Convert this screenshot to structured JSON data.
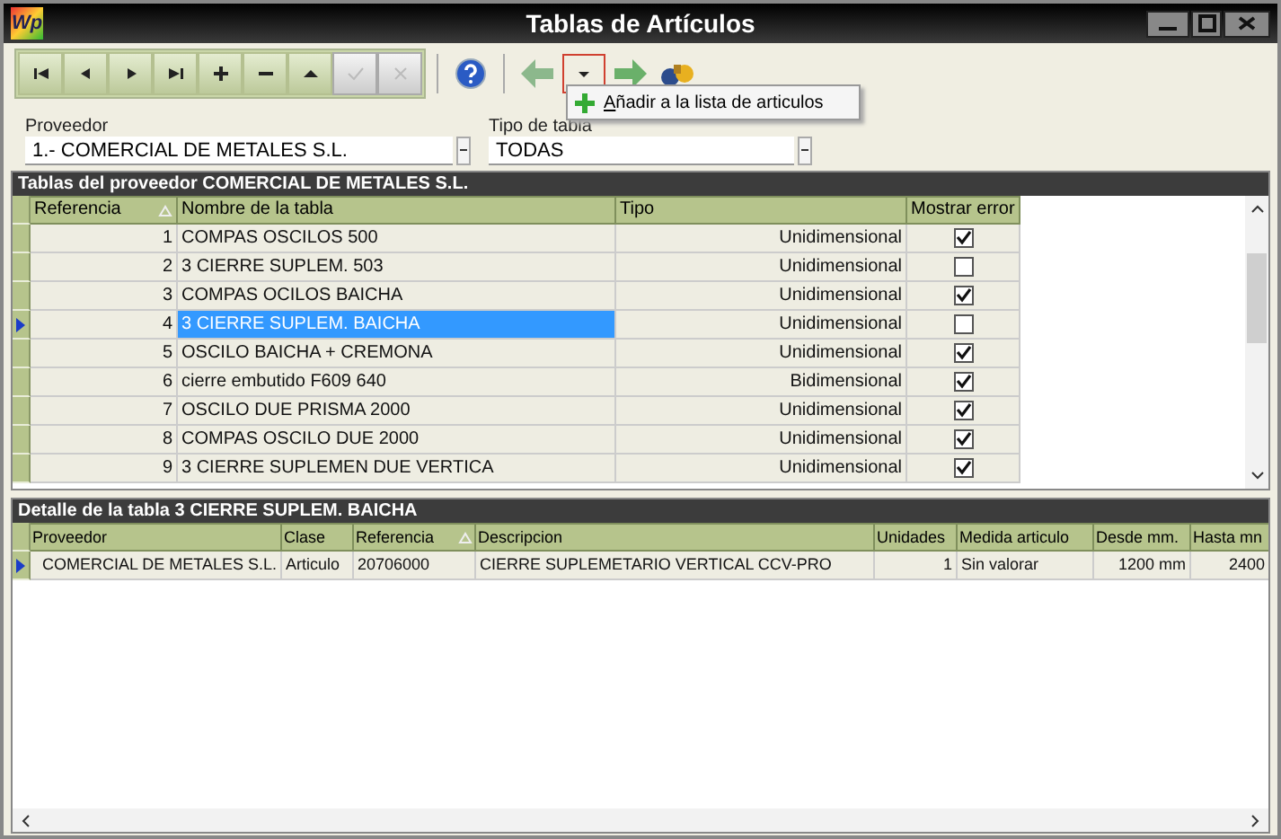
{
  "window": {
    "title": "Tablas de Artículos",
    "logo": "Wp"
  },
  "toolbar": [
    {
      "kind": "first",
      "disabled": false
    },
    {
      "kind": "prev",
      "disabled": false
    },
    {
      "kind": "next",
      "disabled": false
    },
    {
      "kind": "last",
      "disabled": false
    },
    {
      "kind": "add",
      "disabled": false
    },
    {
      "kind": "remove",
      "disabled": false
    },
    {
      "kind": "up",
      "disabled": false
    },
    {
      "kind": "accept",
      "disabled": true
    },
    {
      "kind": "cancel",
      "disabled": true
    },
    {
      "kind": "help"
    },
    {
      "kind": "back"
    },
    {
      "kind": "dropdown",
      "selected": true
    },
    {
      "kind": "forward"
    },
    {
      "kind": "find"
    }
  ],
  "menu": {
    "items": [
      {
        "label": "Añadir a la lista de articulos"
      }
    ]
  },
  "fields": [
    {
      "label": "Proveedor",
      "value": "1.- COMERCIAL DE METALES S.L."
    },
    {
      "label": "Tipo de tabla",
      "value": "TODAS"
    }
  ],
  "tables_panel": {
    "title": "Tablas del proveedor COMERCIAL DE METALES S.L.",
    "columns": [
      "Referencia",
      "Nombre de la tabla",
      "Tipo",
      "Mostrar error"
    ],
    "rows": [
      {
        "ref": "1",
        "name": "COMPAS OSCILOS 500",
        "tipo": "Unidimensional",
        "checked": true,
        "selected": false
      },
      {
        "ref": "2",
        "name": "3 CIERRE SUPLEM. 503",
        "tipo": "Unidimensional",
        "checked": false,
        "selected": false
      },
      {
        "ref": "3",
        "name": "COMPAS OCILOS BAICHA",
        "tipo": "Unidimensional",
        "checked": true,
        "selected": false
      },
      {
        "ref": "4",
        "name": "3 CIERRE SUPLEM. BAICHA",
        "tipo": "Unidimensional",
        "checked": false,
        "selected": true
      },
      {
        "ref": "5",
        "name": "OSCILO BAICHA + CREMONA",
        "tipo": "Unidimensional",
        "checked": true,
        "selected": false
      },
      {
        "ref": "6",
        "name": "cierre embutido F609 640",
        "tipo": "Bidimensional",
        "checked": true,
        "selected": false
      },
      {
        "ref": "7",
        "name": "OSCILO DUE PRISMA 2000",
        "tipo": "Unidimensional",
        "checked": true,
        "selected": false
      },
      {
        "ref": "8",
        "name": "COMPAS OSCILO DUE 2000",
        "tipo": "Unidimensional",
        "checked": true,
        "selected": false
      },
      {
        "ref": "9",
        "name": "3 CIERRE SUPLEMEN DUE VERTICA",
        "tipo": "Unidimensional",
        "checked": true,
        "selected": false
      }
    ]
  },
  "detail_panel": {
    "title": "Detalle de la tabla 3 CIERRE SUPLEM. BAICHA",
    "columns": [
      "Proveedor",
      "Clase",
      "Referencia",
      "Descripcion",
      "Unidades",
      "Medida articulo",
      "Desde mm.",
      "Hasta mn"
    ],
    "rows": [
      {
        "selected": true,
        "cells": [
          "COMERCIAL DE METALES S.L.",
          "Articulo",
          "20706000",
          "CIERRE SUPLEMETARIO VERTICAL CCV-PRO",
          "1",
          "Sin valorar",
          "1200 mm",
          "2400"
        ]
      }
    ]
  }
}
